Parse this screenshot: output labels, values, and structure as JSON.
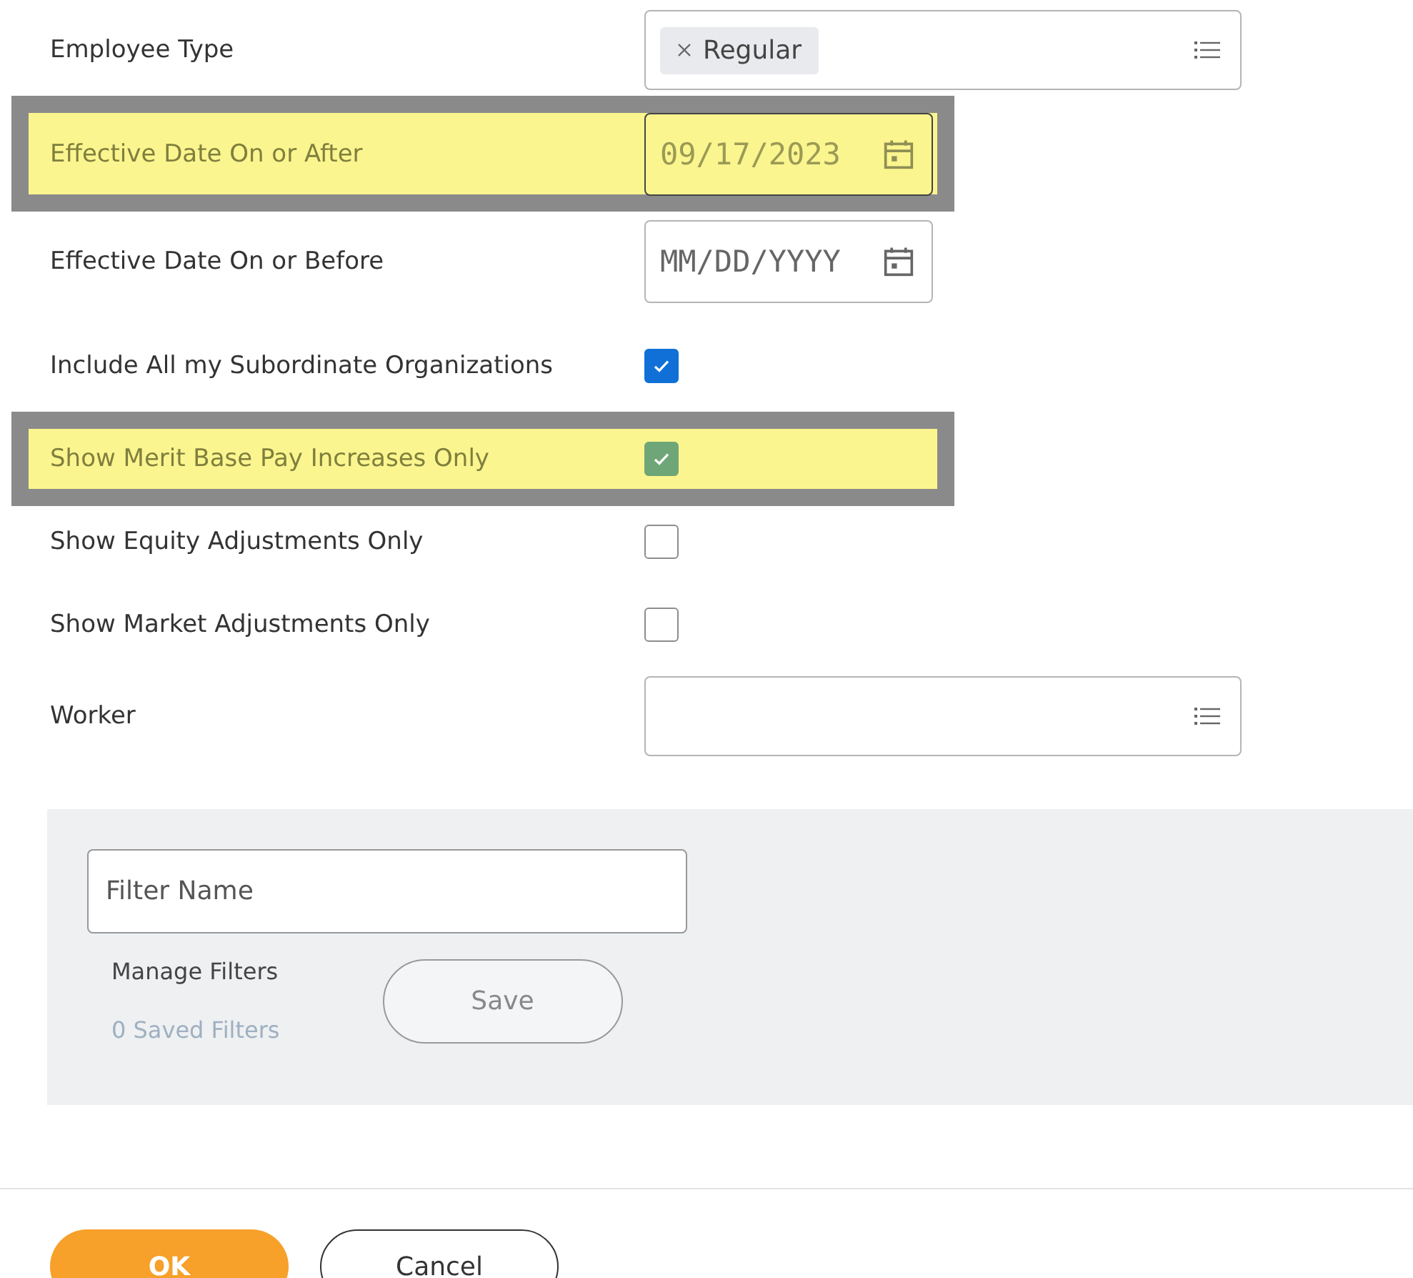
{
  "filters": [
    {
      "kind": "multiselect",
      "label": "Employee Type",
      "highlighted": false,
      "tokens": [
        "Regular"
      ]
    },
    {
      "kind": "date",
      "label": "Effective Date On or After",
      "highlighted": true,
      "value": "09/17/2023"
    },
    {
      "kind": "date",
      "label": "Effective Date On or Before",
      "highlighted": false,
      "placeholder": "MM/DD/YYYY"
    },
    {
      "kind": "checkbox",
      "label": "Include All my Subordinate Organizations",
      "highlighted": false,
      "checked": true
    },
    {
      "kind": "checkbox",
      "label": "Show Merit Base Pay Increases Only",
      "highlighted": true,
      "checked": true
    },
    {
      "kind": "checkbox",
      "label": "Show Equity Adjustments Only",
      "highlighted": false,
      "checked": false
    },
    {
      "kind": "checkbox",
      "label": "Show Market Adjustments Only",
      "highlighted": false,
      "checked": false
    },
    {
      "kind": "multiselect",
      "label": "Worker",
      "highlighted": false
    }
  ],
  "saved_filters": {
    "name_placeholder": "Filter Name",
    "manage_label": "Manage Filters",
    "saved_count": "0 Saved Filters",
    "save_button": "Save"
  },
  "buttons": [
    {
      "label": "OK",
      "kind": "primary"
    },
    {
      "label": "Cancel",
      "kind": "secondary"
    }
  ]
}
